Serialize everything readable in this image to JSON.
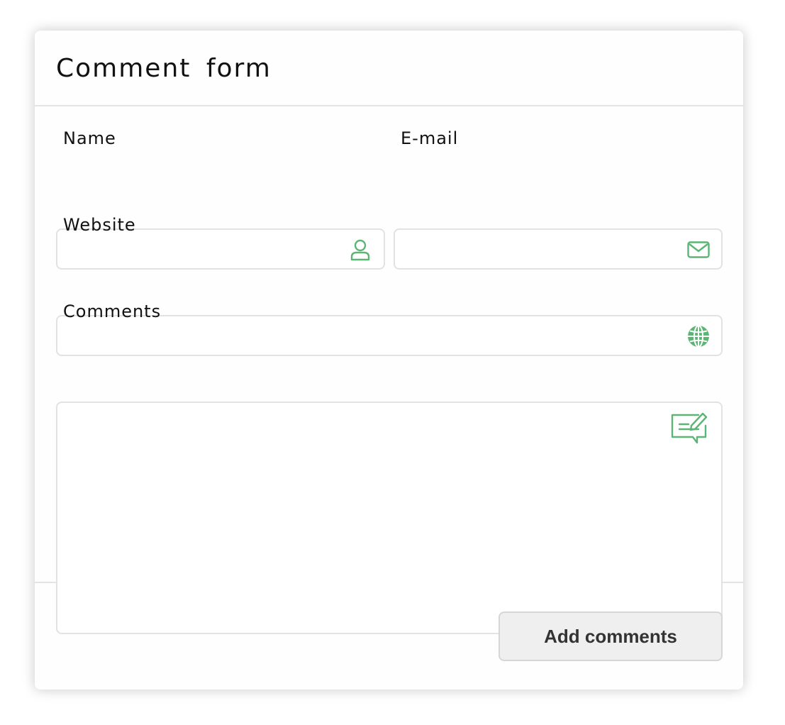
{
  "form": {
    "title": "Comment form",
    "accent_color": "#5db575",
    "fields": {
      "name": {
        "label": "Name",
        "value": "",
        "placeholder": "",
        "icon": "user-icon"
      },
      "email": {
        "label": "E-mail",
        "value": "",
        "placeholder": "",
        "icon": "envelope-icon"
      },
      "website": {
        "label": "Website",
        "value": "",
        "placeholder": "",
        "icon": "globe-icon"
      },
      "comments": {
        "label": "Comments",
        "value": "",
        "placeholder": "",
        "icon": "comment-edit-icon"
      }
    },
    "submit_label": "Add comments"
  }
}
